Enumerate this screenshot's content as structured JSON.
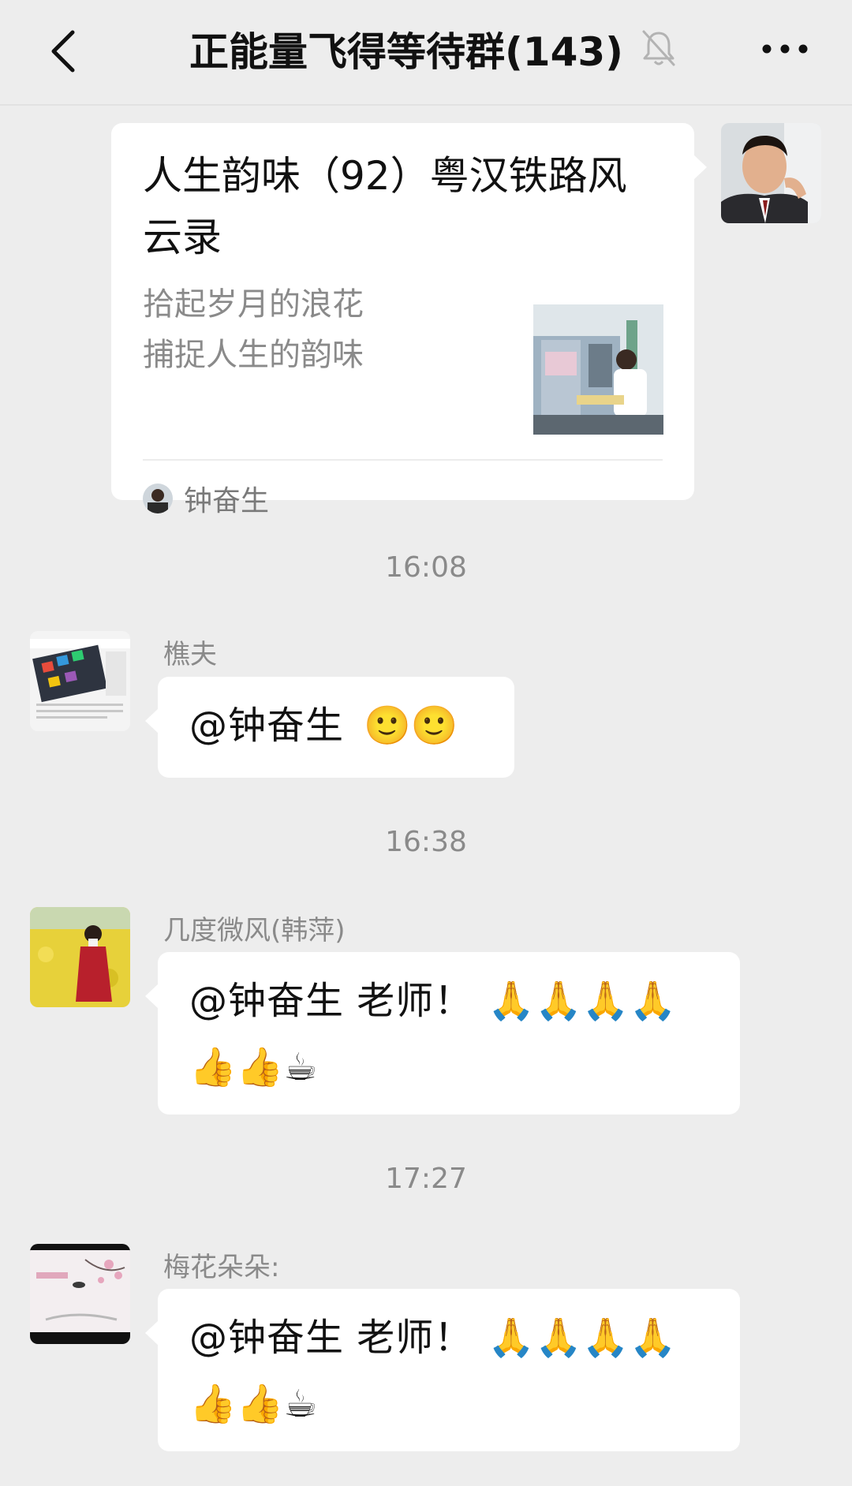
{
  "header": {
    "back_icon": "chevron-left-icon",
    "title": "正能量飞得等待群(143)",
    "mute_icon": "bell-off-icon",
    "more_icon": "more-dots-icon"
  },
  "article_card": {
    "title": "人生韵味（92）粤汉铁路风云录",
    "desc_line1": "拾起岁月的浪花",
    "desc_line2": "捕捉人生的韵味",
    "source": "钟奋生"
  },
  "messages": [
    {
      "time": "16:08",
      "sender": "樵夫",
      "text": "@钟奋生",
      "emojis": "🙂🙂"
    },
    {
      "time": "16:38",
      "sender": "几度微风(韩萍)",
      "text": "@钟奋生  老师！",
      "emojis_line1": "🙏🙏🙏🙏",
      "emojis_line2": "👍👍☕"
    },
    {
      "time": "17:27",
      "sender": "梅花朵朵:",
      "text": "@钟奋生  老师！",
      "emojis_line1": "🙏🙏🙏🙏",
      "emojis_line2": "👍👍☕"
    }
  ],
  "colors": {
    "background": "#ededed",
    "bubble": "#ffffff",
    "secondary_text": "#8a8a8a"
  }
}
